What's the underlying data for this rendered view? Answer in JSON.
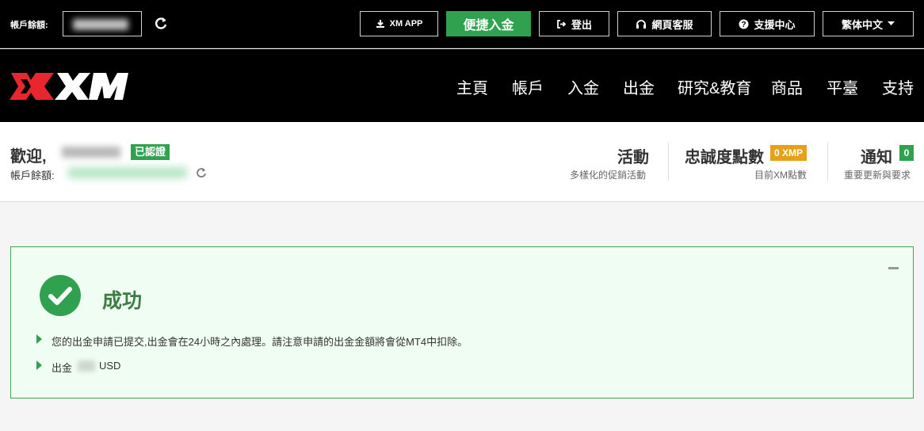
{
  "topbar": {
    "balance_label": "帳戶餘額:",
    "xm_app": "XM APP",
    "quick_deposit": "便捷入金",
    "logout": "登出",
    "web_support": "網頁客服",
    "help_center": "支援中心",
    "language": "繁体中文"
  },
  "nav": {
    "items": [
      "主頁",
      "帳戶",
      "入金",
      "出金",
      "研究&教育",
      "商品",
      "平臺",
      "支持"
    ]
  },
  "welcome": {
    "greeting": "歡迎,",
    "verified": "已認證",
    "balance_label": "帳戶餘額:",
    "promo_title": "活動",
    "promo_sub": "多樣化的促銷活動",
    "loyalty_title": "忠誠度點數",
    "loyalty_badge": "0 XMP",
    "loyalty_sub": "目前XM點數",
    "notify_title": "通知",
    "notify_count": "0",
    "notify_sub": "重要更新與要求"
  },
  "result": {
    "title": "成功",
    "message": "您的出金申請已提交,出金會在24小時之內處理。請注意申請的出金金額將會從MT4中扣除。",
    "amount_prefix": "出金",
    "currency": "USD"
  },
  "colors": {
    "brand_green": "#2fa14f",
    "brand_red": "#e8262d",
    "badge_orange": "#e6a019"
  }
}
